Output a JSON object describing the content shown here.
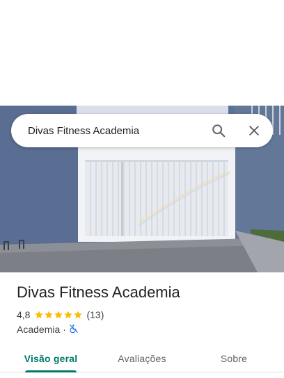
{
  "search": {
    "query": "Divas Fitness Academia"
  },
  "place": {
    "name": "Divas Fitness Academia",
    "rating": "4,8",
    "stars": 5,
    "review_count": "(13)",
    "category": "Academia",
    "separator": "·"
  },
  "tabs": [
    {
      "label": "Visão geral"
    },
    {
      "label": "Avaliações"
    },
    {
      "label": "Sobre"
    }
  ],
  "colors": {
    "accent": "#00796b",
    "star": "#fbbc04",
    "accessibility_icon": "#1a73e8"
  },
  "icons": {
    "search": "search-icon",
    "close": "close-icon",
    "star": "star-icon",
    "accessibility": "wheelchair-not-accessible-icon"
  }
}
